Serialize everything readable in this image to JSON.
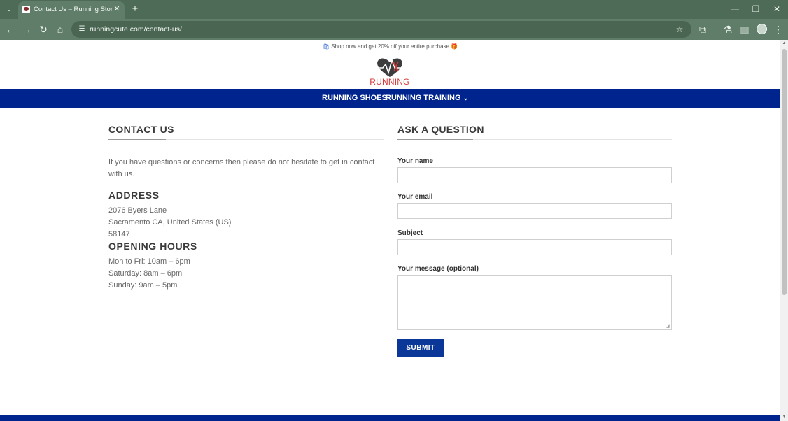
{
  "browser": {
    "tab_title": "Contact Us – Running Store – N",
    "url": "runningcute.com/contact-us/",
    "tab_list_glyph": "⌄",
    "tab_close_glyph": "✕",
    "new_tab_glyph": "+",
    "minimize_glyph": "—",
    "restore_glyph": "❐",
    "close_glyph": "✕",
    "back_glyph": "←",
    "forward_glyph": "→",
    "reload_glyph": "↻",
    "home_glyph": "⌂",
    "site_info_glyph": "☰",
    "bookmark_glyph": "☆",
    "extensions_glyph": "⧉",
    "lab_glyph": "⚗",
    "sidebar_glyph": "▥",
    "menu_glyph": "⋮",
    "theme_color": "#5f7d68",
    "tabbar_color": "#4e6b57"
  },
  "promo": {
    "bag_icon": "🛍",
    "text": "Shop now and get 20% off your entire purchase",
    "gift_icon": "🎁"
  },
  "logo": {
    "text": "RUNNING",
    "color": "#d6393a"
  },
  "nav": {
    "items": [
      {
        "label": "RUNNING SHOES"
      },
      {
        "label": "RUNNING TRAINING",
        "caret": "⌄"
      }
    ],
    "color": "#00248d"
  },
  "contact": {
    "title": "CONTACT US",
    "intro": "If you have questions or concerns then please do not hesitate to get in contact with us.",
    "address_heading": "ADDRESS",
    "address_lines": [
      "2076 Byers Lane",
      "Sacramento CA, United States (US)",
      "58147"
    ],
    "hours_heading": "OPENING HOURS",
    "hours_lines": [
      "Mon to Fri: 10am – 6pm",
      "Saturday: 8am – 6pm",
      "Sunday: 9am – 5pm"
    ]
  },
  "form": {
    "title": "ASK A QUESTION",
    "name_label": "Your name",
    "name_value": "",
    "email_label": "Your email",
    "email_value": "",
    "subject_label": "Subject",
    "subject_value": "",
    "message_label": "Your message (optional)",
    "message_value": "",
    "submit_label": "SUBMIT",
    "button_color": "#0b3898"
  },
  "scrollbar": {
    "up_glyph": "▲",
    "down_glyph": "▼"
  }
}
